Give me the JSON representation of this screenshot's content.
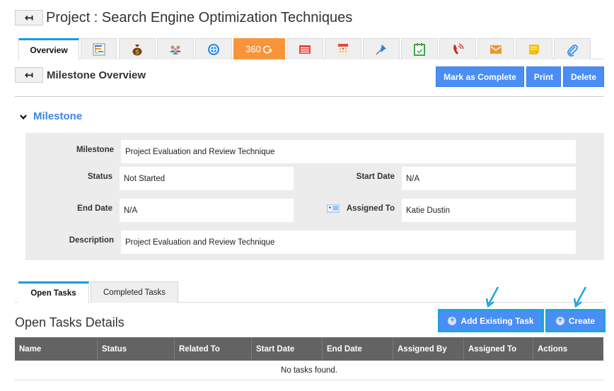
{
  "header": {
    "back_icon": "back-arrow-icon",
    "back_glyph": "↤",
    "title": "Project : Search Engine Optimization Techniques"
  },
  "tabs": [
    {
      "label": "Overview",
      "icon": null,
      "active": true
    },
    {
      "label": "",
      "icon": "gantt-chart-icon"
    },
    {
      "label": "",
      "icon": "money-bag-icon"
    },
    {
      "label": "",
      "icon": "users-group-icon"
    },
    {
      "label": "",
      "icon": "globe-icon"
    },
    {
      "label": "360",
      "icon": "refresh-360-icon",
      "highlight_color": "#f8953a"
    },
    {
      "label": "",
      "icon": "list-document-icon"
    },
    {
      "label": "",
      "icon": "calendar-icon"
    },
    {
      "label": "",
      "icon": "pin-icon"
    },
    {
      "label": "",
      "icon": "calendar-check-icon"
    },
    {
      "label": "",
      "icon": "phone-call-icon"
    },
    {
      "label": "",
      "icon": "envelope-icon"
    },
    {
      "label": "",
      "icon": "sticky-note-icon"
    },
    {
      "label": "",
      "icon": "paperclip-icon"
    }
  ],
  "milestone_header": {
    "back_glyph": "↤",
    "title": "Milestone Overview",
    "buttons": {
      "mark_complete": "Mark as Complete",
      "print": "Print",
      "delete": "Delete"
    }
  },
  "milestone_section": {
    "toggle_glyph": "⌄",
    "title": "Milestone",
    "fields": {
      "milestone": {
        "label": "Milestone",
        "value": "Project Evaluation and Review Technique"
      },
      "status": {
        "label": "Status",
        "value": "Not Started"
      },
      "start_date": {
        "label": "Start Date",
        "value": "N/A"
      },
      "end_date": {
        "label": "End Date",
        "value": "N/A"
      },
      "assigned_to": {
        "label": "Assigned To",
        "value": "Katie Dustin",
        "icon": "contact-card-icon"
      },
      "description": {
        "label": "Description",
        "value": "Project Evaluation and Review Technique"
      }
    }
  },
  "sub_tabs": [
    {
      "label": "Open Tasks",
      "active": true
    },
    {
      "label": "Completed Tasks",
      "active": false
    }
  ],
  "open_tasks": {
    "title": "Open Tasks Details",
    "buttons": {
      "add_existing": "Add Existing Task",
      "create": "Create",
      "plus_glyph": "+"
    },
    "columns": [
      "Name",
      "Status",
      "Related To",
      "Start Date",
      "End Date",
      "Assigned By",
      "Assigned To",
      "Actions"
    ],
    "empty_message": "No tasks found."
  },
  "colors": {
    "accent_blue": "#4a8ef5",
    "tab_active_border": "#1a9ae0",
    "highlight_orange": "#f8953a",
    "annotation_arrow": "#1fa3e0",
    "table_header": "#636363"
  }
}
